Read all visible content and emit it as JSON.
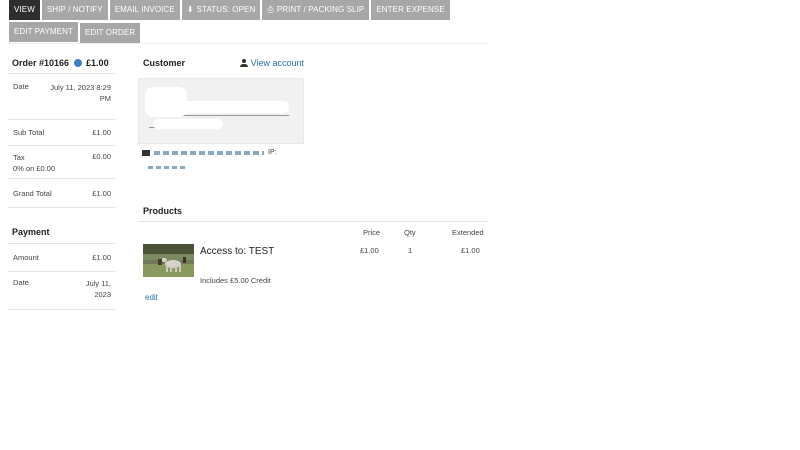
{
  "toolbar": {
    "buttons": [
      {
        "label": "VIEW",
        "icon": ""
      },
      {
        "label": "SHIP / NOTIFY",
        "icon": ""
      },
      {
        "label": "EMAIL INVOICE",
        "icon": ""
      },
      {
        "label": "STATUS: OPEN",
        "icon": "download-icon"
      },
      {
        "label": "PRINT / PACKING SLIP",
        "icon": "printer-icon"
      },
      {
        "label": "ENTER EXPENSE",
        "icon": ""
      },
      {
        "label": "EDIT PAYMENT",
        "icon": ""
      },
      {
        "label": "EDIT ORDER",
        "icon": ""
      }
    ],
    "active_color": "#2e2e2e",
    "button_color": "#a7a7a7"
  },
  "order": {
    "title": "Order #10166",
    "amount": "£1.00",
    "date_label": "Date",
    "date_value": "July 11, 2023 8:29 PM",
    "subtotal_label": "Sub Total",
    "subtotal_value": "£1.00",
    "tax_label": "Tax",
    "tax_note": "0% on £0.00",
    "tax_value": "£0.00",
    "grand_label": "Grand Total",
    "grand_value": "£1.00"
  },
  "payment": {
    "title": "Payment",
    "amount_label": "Amount",
    "amount_value": "£1.00",
    "date_label": "Date",
    "date_value": "July 11, 2023"
  },
  "customer": {
    "title": "Customer",
    "view_account": "View account",
    "ip_label": "IP:"
  },
  "products": {
    "title": "Products",
    "columns": {
      "price": "Price",
      "qty": "Qty",
      "extended": "Extended"
    },
    "items": [
      {
        "name": "Access to: TEST",
        "note": "Includes £5.00 Credit",
        "price": "£1.00",
        "qty": "1",
        "extended": "£1.00"
      }
    ],
    "edit_label": "edit"
  },
  "colors": {
    "link": "#2b6ea8",
    "globe": "#3d7fbf"
  }
}
